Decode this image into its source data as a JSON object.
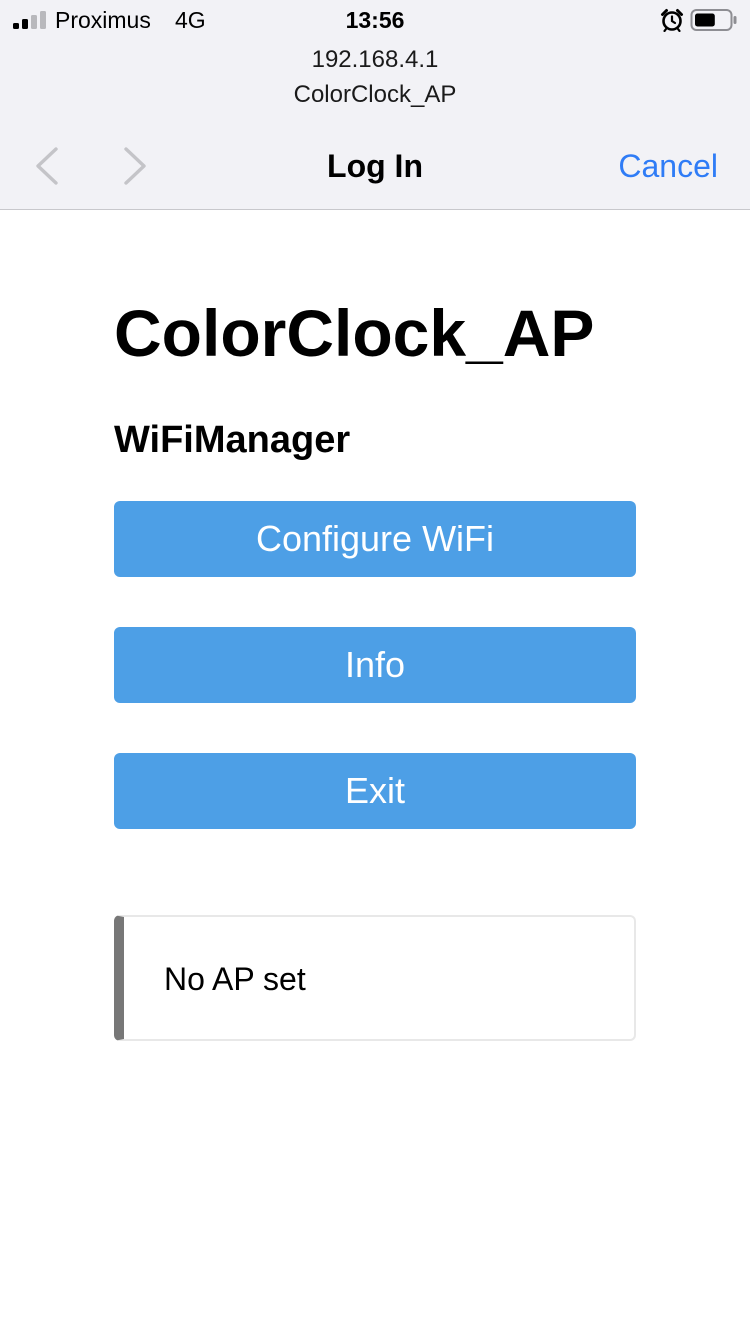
{
  "status_bar": {
    "carrier": "Proximus",
    "network": "4G",
    "time": "13:56",
    "signal_bars_active": 2,
    "signal_bars_total": 4,
    "battery_level": 0.6,
    "alarm_icon": "alarm-clock-icon",
    "battery_icon": "battery-icon"
  },
  "sheet": {
    "url": "192.168.4.1",
    "subtitle": "ColorClock_AP",
    "title": "Log In",
    "cancel_label": "Cancel",
    "back_icon": "chevron-left-icon",
    "forward_icon": "chevron-right-icon"
  },
  "page": {
    "heading": "ColorClock_AP",
    "subheading": "WiFiManager",
    "buttons": [
      {
        "label": "Configure WiFi"
      },
      {
        "label": "Info"
      },
      {
        "label": "Exit"
      }
    ],
    "message": "No AP set"
  },
  "colors": {
    "accent_link": "#2f7cf6",
    "button_bg": "#4d9fe6",
    "chrome_bg": "#f2f2f6",
    "message_border": "#777777"
  }
}
